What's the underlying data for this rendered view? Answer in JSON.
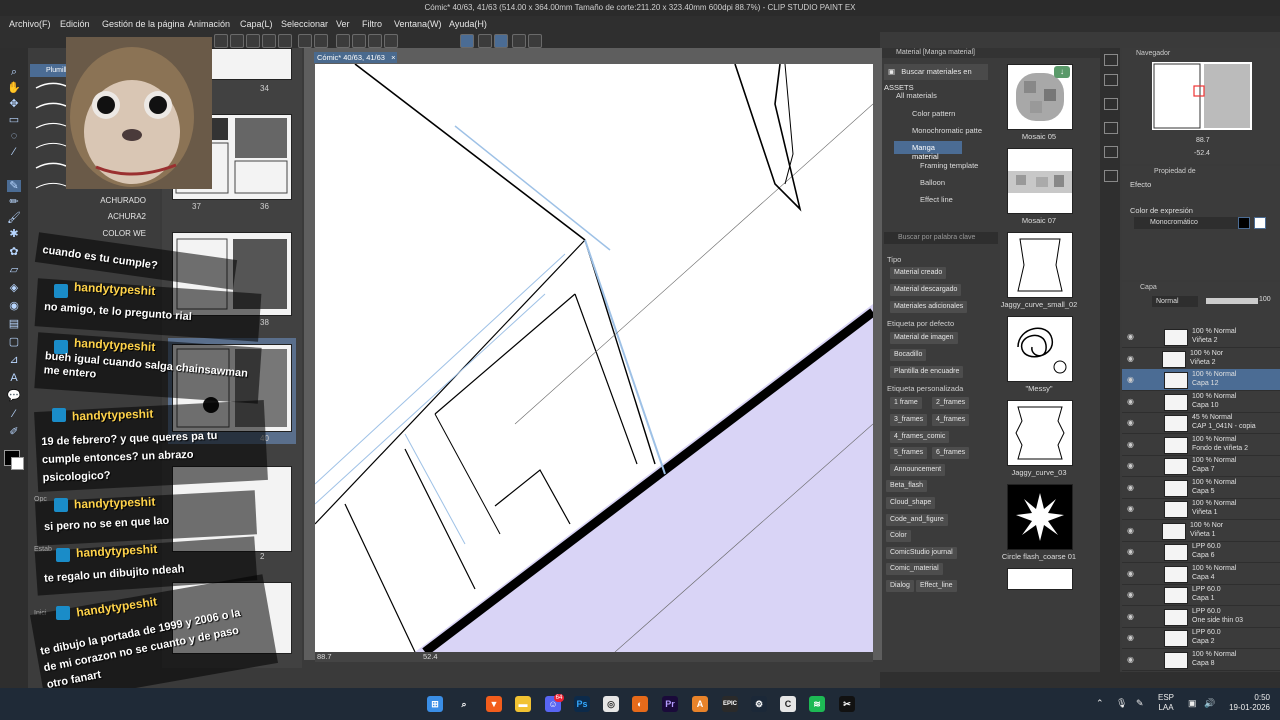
{
  "window": {
    "title": "Cómic* 40/63, 41/63 (514.00 x 364.00mm Tamaño de corte:211.20 x 323.40mm 600dpi 88.7%) - CLIP STUDIO PAINT EX"
  },
  "menu": [
    "Archivo(F)",
    "Edición",
    "Gestión de la página",
    "Animación",
    "Capa(L)",
    "Seleccionar",
    "Ver",
    "Filtro",
    "Ventana(W)",
    "Ayuda(H)"
  ],
  "canvas": {
    "tab_label": "Cómic* 40/63, 41/63",
    "tab_close": "×",
    "zoom": "88.7",
    "angle": "52.4"
  },
  "subtool": {
    "tab_label": "Plumill",
    "brushes": [
      "ACHURADO",
      "ACHURA2",
      "COLOR WE"
    ],
    "hidden_labels": [
      "Opc",
      "Estab",
      "Inici"
    ]
  },
  "pages": {
    "numbers": [
      "34",
      "37",
      "36",
      "38",
      "40",
      "2"
    ]
  },
  "chat": [
    {
      "user": "",
      "message": "cuando es tu cumple?"
    },
    {
      "user": "handytypeshit",
      "message": "no amigo, te lo pregunto rial"
    },
    {
      "user": "handytypeshit",
      "message": "bueh igual cuando salga chainsawman\nme entero"
    },
    {
      "user": "handytypeshit",
      "message": "19 de febrero? y que queres pa tu\ncumple entonces? un abrazo\npsicologico?"
    },
    {
      "user": "handytypeshit",
      "message": "si pero no se en que lao"
    },
    {
      "user": "handytypeshit",
      "message": "te regalo un dibujito ndeah"
    },
    {
      "user": "handytypeshit",
      "message": "te dibujo la portada de 1999 y 2006 o la\nde mi corazon no se cuanto y de paso\notro fanart"
    }
  ],
  "material": {
    "panel_title": "Material [Manga material]",
    "search_assets": "Buscar materiales en ASSETS",
    "tree": [
      "All materials",
      "Color pattern",
      "Monochromatic patte",
      "Manga material",
      "Framing template",
      "Balloon",
      "Effect line"
    ],
    "keyword_placeholder": "Buscar por palabra clave",
    "section_tipo": "Tipo",
    "tipo_chips": [
      "Material creado",
      "Material descargado",
      "Materiales adicionales"
    ],
    "section_defecto": "Etiqueta por defecto",
    "defecto_chips": [
      "Material de imagen",
      "Bocadillo",
      "Plantilla de encuadre"
    ],
    "section_personalizada": "Etiqueta personalizada",
    "custom_chips": [
      "1 frame",
      "2_frames",
      "3_frames",
      "4_frames",
      "4_frames_comic",
      "5_frames",
      "6_frames",
      "Announcement",
      "Beta_flash",
      "Cloud_shape",
      "Code_and_figure",
      "Color",
      "ComicStudio journal",
      "Comic_material",
      "Dialog",
      "Effect_line"
    ],
    "thumbs": [
      "Mosaic 05",
      "Mosaic 07",
      "Jaggy_curve_small_02",
      "\"Messy\"",
      "Jaggy_curve_03",
      "Circle flash_coarse 01"
    ]
  },
  "navigator": {
    "title": "Navegador",
    "zoom": "88.7",
    "angle": "-52.4"
  },
  "properties": {
    "title": "Propiedad de",
    "effect_label": "Efecto",
    "color_expr_label": "Color de expresión",
    "color_expr_value": "Monocromático"
  },
  "layers": {
    "title": "Capa",
    "blend_mode": "Normal",
    "opacity": "100",
    "items": [
      {
        "l1": "100 % Normal",
        "l2": "Viñeta 2"
      },
      {
        "l1": "100 % Nor",
        "l2": "Viñeta 2"
      },
      {
        "l1": "100 % Normal",
        "l2": "Capa 12"
      },
      {
        "l1": "100 % Normal",
        "l2": "Capa 10"
      },
      {
        "l1": "45 % Normal",
        "l2": "CAP 1_041N - copia"
      },
      {
        "l1": "100 % Normal",
        "l2": "Fondo de viñeta 2"
      },
      {
        "l1": "100 % Normal",
        "l2": "Capa 7"
      },
      {
        "l1": "100 % Normal",
        "l2": "Capa 5"
      },
      {
        "l1": "100 % Normal",
        "l2": "Viñeta 1"
      },
      {
        "l1": "100 % Nor",
        "l2": "Viñeta 1"
      },
      {
        "l1": "LPP 60.0",
        "l2": "Capa 6"
      },
      {
        "l1": "100 % Normal",
        "l2": "Capa 4"
      },
      {
        "l1": "LPP 60.0",
        "l2": "Capa 1"
      },
      {
        "l1": "LPP 60.0",
        "l2": "One side thin 03"
      },
      {
        "l1": "LPP 60.0",
        "l2": "Capa 2"
      },
      {
        "l1": "100 % Normal",
        "l2": "Capa 8"
      }
    ]
  },
  "taskbar": {
    "badge": "64",
    "lang_1": "ESP",
    "lang_2": "LAA",
    "time": "0:50",
    "date": "19-01-2026",
    "icons": [
      "windows-icon",
      "search-icon",
      "brave-icon",
      "file-explorer-icon",
      "discord-icon",
      "photoshop-icon",
      "chrome-icon",
      "firefox-icon",
      "premiere-icon",
      "aseprite-icon",
      "epic-games-icon",
      "steam-icon",
      "clip-studio-icon",
      "spotify-icon",
      "capcut-icon"
    ]
  },
  "colors": {
    "canvas_fill": "#d9d4f6",
    "sketch": "#9ec1e6",
    "yt_blue": "#1a8cc8",
    "name_yellow": "#ffd34a"
  }
}
